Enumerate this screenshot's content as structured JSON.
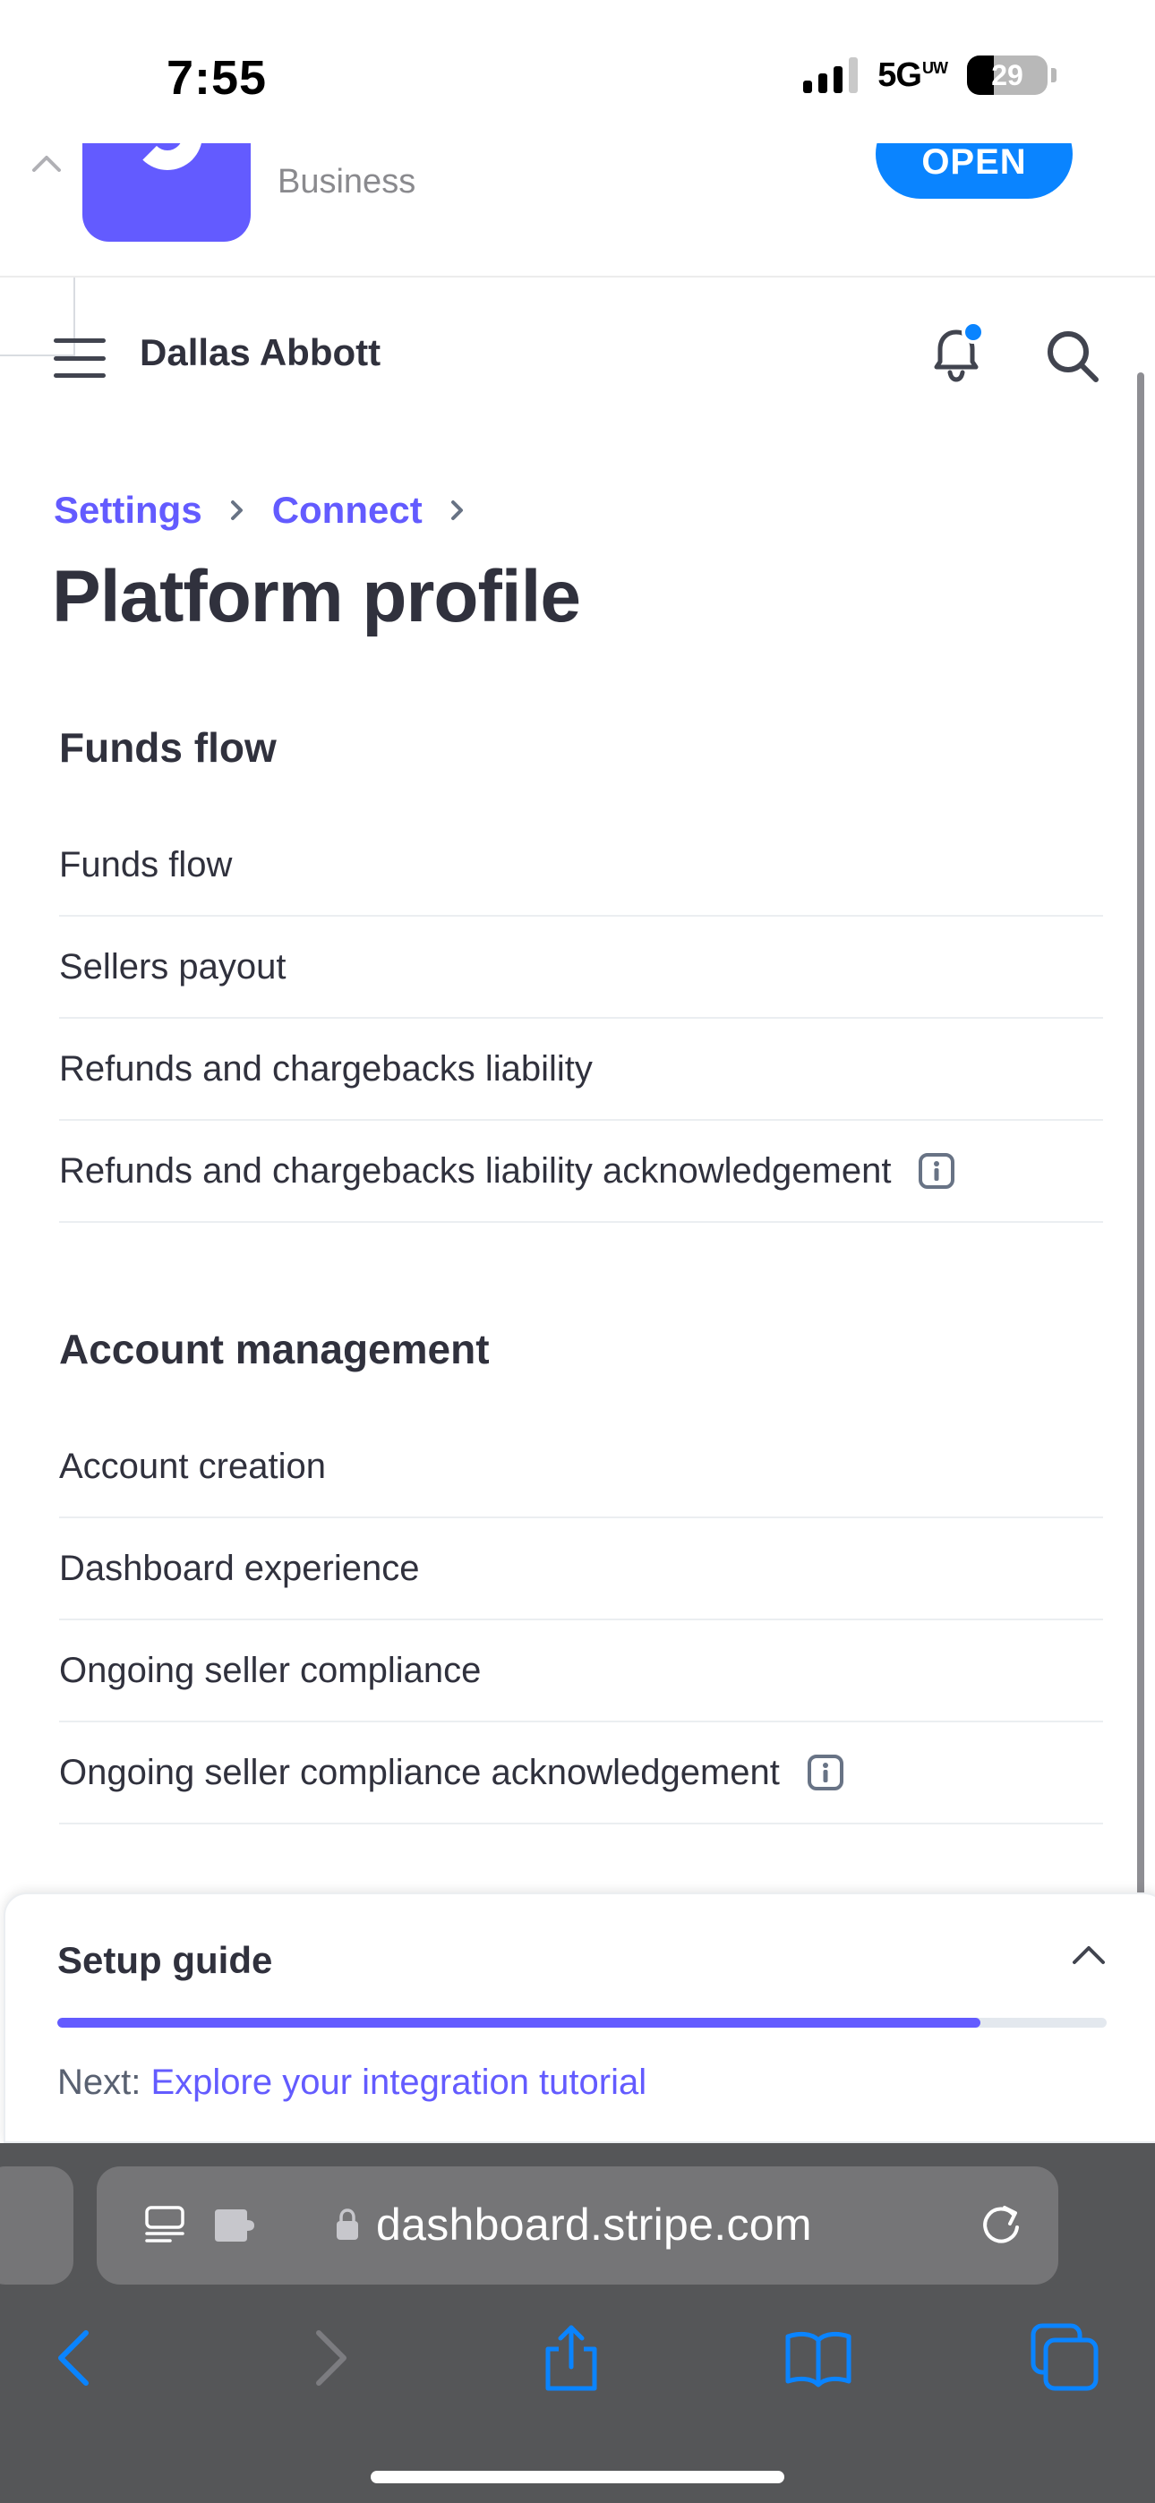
{
  "status_bar": {
    "time": "7:55",
    "network": "5G",
    "network_sub": "UW",
    "battery": "29"
  },
  "app_banner": {
    "subtitle": "Business",
    "open_label": "OPEN",
    "icon": "stripe-app-icon",
    "brand_color": "#635bff",
    "button_color": "#0a84ff"
  },
  "nav": {
    "account_name": "Dallas Abbott",
    "menu_icon": "hamburger-icon",
    "notification_icon": "bell-icon",
    "search_icon": "search-icon"
  },
  "breadcrumb": {
    "items": [
      "Settings",
      "Connect"
    ]
  },
  "page": {
    "title": "Platform profile"
  },
  "sections": [
    {
      "title": "Funds flow",
      "items": [
        {
          "label": "Funds flow"
        },
        {
          "label": "Sellers payout"
        },
        {
          "label": "Refunds and chargebacks liability"
        },
        {
          "label": "Refunds and chargebacks liability acknowledgement",
          "info": true
        }
      ]
    },
    {
      "title": "Account management",
      "items": [
        {
          "label": "Account creation"
        },
        {
          "label": "Dashboard experience"
        },
        {
          "label": "Ongoing seller compliance"
        },
        {
          "label": "Ongoing seller compliance acknowledgement",
          "info": true
        }
      ]
    }
  ],
  "setup_guide": {
    "title": "Setup guide",
    "progress": 0.88,
    "next_prefix": "Next:",
    "next_link": "Explore your integration tutorial"
  },
  "safari": {
    "url": "dashboard.stripe.com",
    "icons": [
      "reader-icon",
      "extension-icon",
      "lock-icon",
      "reload-icon",
      "back-icon",
      "forward-icon",
      "share-icon",
      "bookmarks-icon",
      "tabs-icon"
    ]
  },
  "colors": {
    "accent": "#635bff",
    "text": "#30313d",
    "divider": "#ebeef1",
    "safari_tint": "#0a84ff"
  }
}
